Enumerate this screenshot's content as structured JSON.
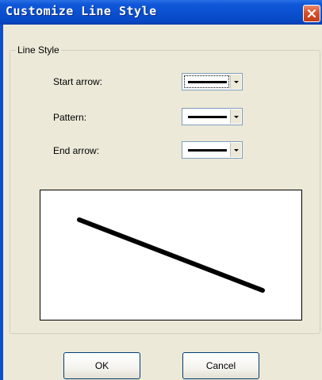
{
  "window": {
    "title": "Customize Line Style"
  },
  "group": {
    "label": "Line Style"
  },
  "fields": {
    "start_arrow": {
      "label": "Start arrow:",
      "selected": "solid-line"
    },
    "pattern": {
      "label": "Pattern:",
      "selected": "solid-line"
    },
    "end_arrow": {
      "label": "End arrow:",
      "selected": "solid-line"
    }
  },
  "buttons": {
    "ok_label": "OK",
    "cancel_label": "Cancel"
  },
  "icons": {
    "close": "close-icon",
    "dropdown": "chevron-down-icon"
  },
  "colors": {
    "titlebar": "#0a4fcf",
    "close_button": "#d8502a",
    "dialog_background": "#ece9d8",
    "preview_line": "#000000"
  }
}
